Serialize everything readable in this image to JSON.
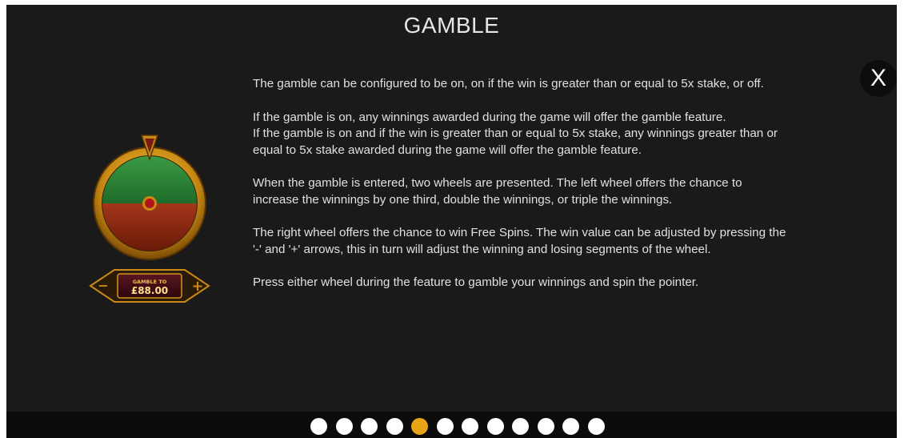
{
  "title": "GAMBLE",
  "close_label": "X",
  "paragraphs": [
    [
      "The gamble can be configured to be on, on if the win is greater than or equal to 5x stake, or off."
    ],
    [
      "If the gamble is on, any winnings awarded during the game will offer the gamble feature.",
      "If the gamble is on and if the win is greater than or equal to 5x stake, any winnings greater than or equal to 5x stake awarded during the game will offer the gamble feature."
    ],
    [
      "When the gamble is entered, two wheels are presented. The left wheel offers the chance to increase the winnings by one third, double the winnings, or triple the winnings."
    ],
    [
      "The right wheel offers the chance to win Free Spins. The win value can be adjusted by pressing the '-' and '+' arrows, this in turn will adjust the winning and losing segments of the wheel."
    ],
    [
      "Press either wheel during the feature to gamble your winnings and spin the pointer."
    ]
  ],
  "wheel_panel": {
    "label": "GAMBLE TO",
    "amount": "£88.00",
    "minus": "−",
    "plus": "+"
  },
  "colors": {
    "accent": "#e8a317",
    "wheel_green": "#2f8a3a",
    "wheel_red": "#9b2a12",
    "gold": "#d4961e"
  },
  "pagination": {
    "total": 12,
    "active_index": 4
  }
}
